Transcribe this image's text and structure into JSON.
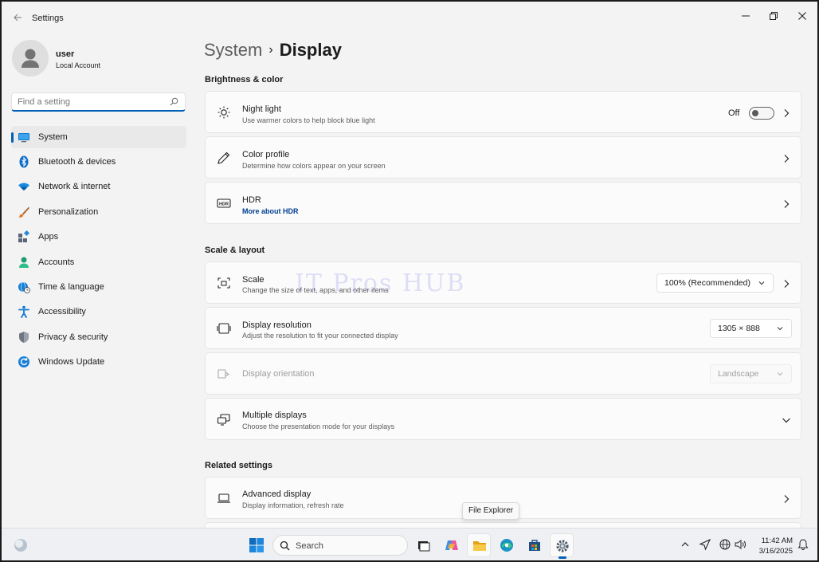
{
  "window": {
    "title": "Settings"
  },
  "profile": {
    "name": "user",
    "account_type": "Local Account"
  },
  "search": {
    "placeholder": "Find a setting"
  },
  "sidebar": {
    "items": [
      {
        "label": "System",
        "icon": "system-icon",
        "active": true
      },
      {
        "label": "Bluetooth & devices",
        "icon": "bluetooth-icon"
      },
      {
        "label": "Network & internet",
        "icon": "wifi-icon"
      },
      {
        "label": "Personalization",
        "icon": "brush-icon"
      },
      {
        "label": "Apps",
        "icon": "apps-icon"
      },
      {
        "label": "Accounts",
        "icon": "accounts-icon"
      },
      {
        "label": "Time & language",
        "icon": "globe-clock-icon"
      },
      {
        "label": "Accessibility",
        "icon": "accessibility-icon"
      },
      {
        "label": "Privacy & security",
        "icon": "shield-icon"
      },
      {
        "label": "Windows Update",
        "icon": "update-icon"
      }
    ]
  },
  "breadcrumb": {
    "parent": "System",
    "separator": "›",
    "current": "Display"
  },
  "sections": {
    "brightness": "Brightness & color",
    "scale_layout": "Scale & layout",
    "related": "Related settings"
  },
  "night_light": {
    "title": "Night light",
    "subtitle": "Use warmer colors to help block blue light",
    "state": "Off"
  },
  "color_profile": {
    "title": "Color profile",
    "subtitle": "Determine how colors appear on your screen"
  },
  "hdr": {
    "title": "HDR",
    "link": "More about HDR"
  },
  "scale": {
    "title": "Scale",
    "subtitle": "Change the size of text, apps, and other items",
    "value": "100% (Recommended)"
  },
  "resolution": {
    "title": "Display resolution",
    "subtitle": "Adjust the resolution to fit your connected display",
    "value": "1305 × 888"
  },
  "orientation": {
    "title": "Display orientation",
    "value": "Landscape"
  },
  "multiple_displays": {
    "title": "Multiple displays",
    "subtitle": "Choose the presentation mode for your displays"
  },
  "advanced_display": {
    "title": "Advanced display",
    "subtitle": "Display information, refresh rate"
  },
  "watermark": "IT Pros HUB",
  "tooltip": "File Explorer",
  "taskbar": {
    "search_label": "Search",
    "time": "11:42 AM",
    "date": "3/16/2025"
  },
  "colors": {
    "accent": "#005fb8",
    "background": "#f3f3f3",
    "card": "#fbfbfb"
  }
}
